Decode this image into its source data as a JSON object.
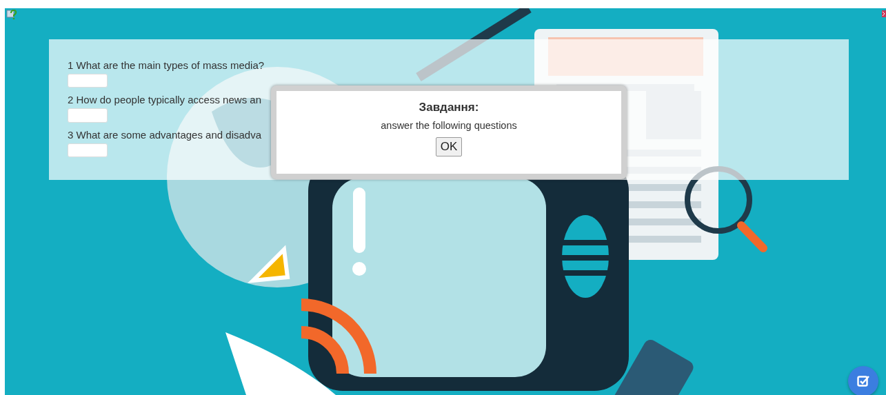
{
  "questions": [
    {
      "text": "1 What are the main types of mass media?"
    },
    {
      "text": "2 How do people typically access news an"
    },
    {
      "text": "3 What are some advantages and disadva"
    }
  ],
  "dialog": {
    "title": "Завдання:",
    "message": "answer the following questions",
    "button": "OK"
  }
}
